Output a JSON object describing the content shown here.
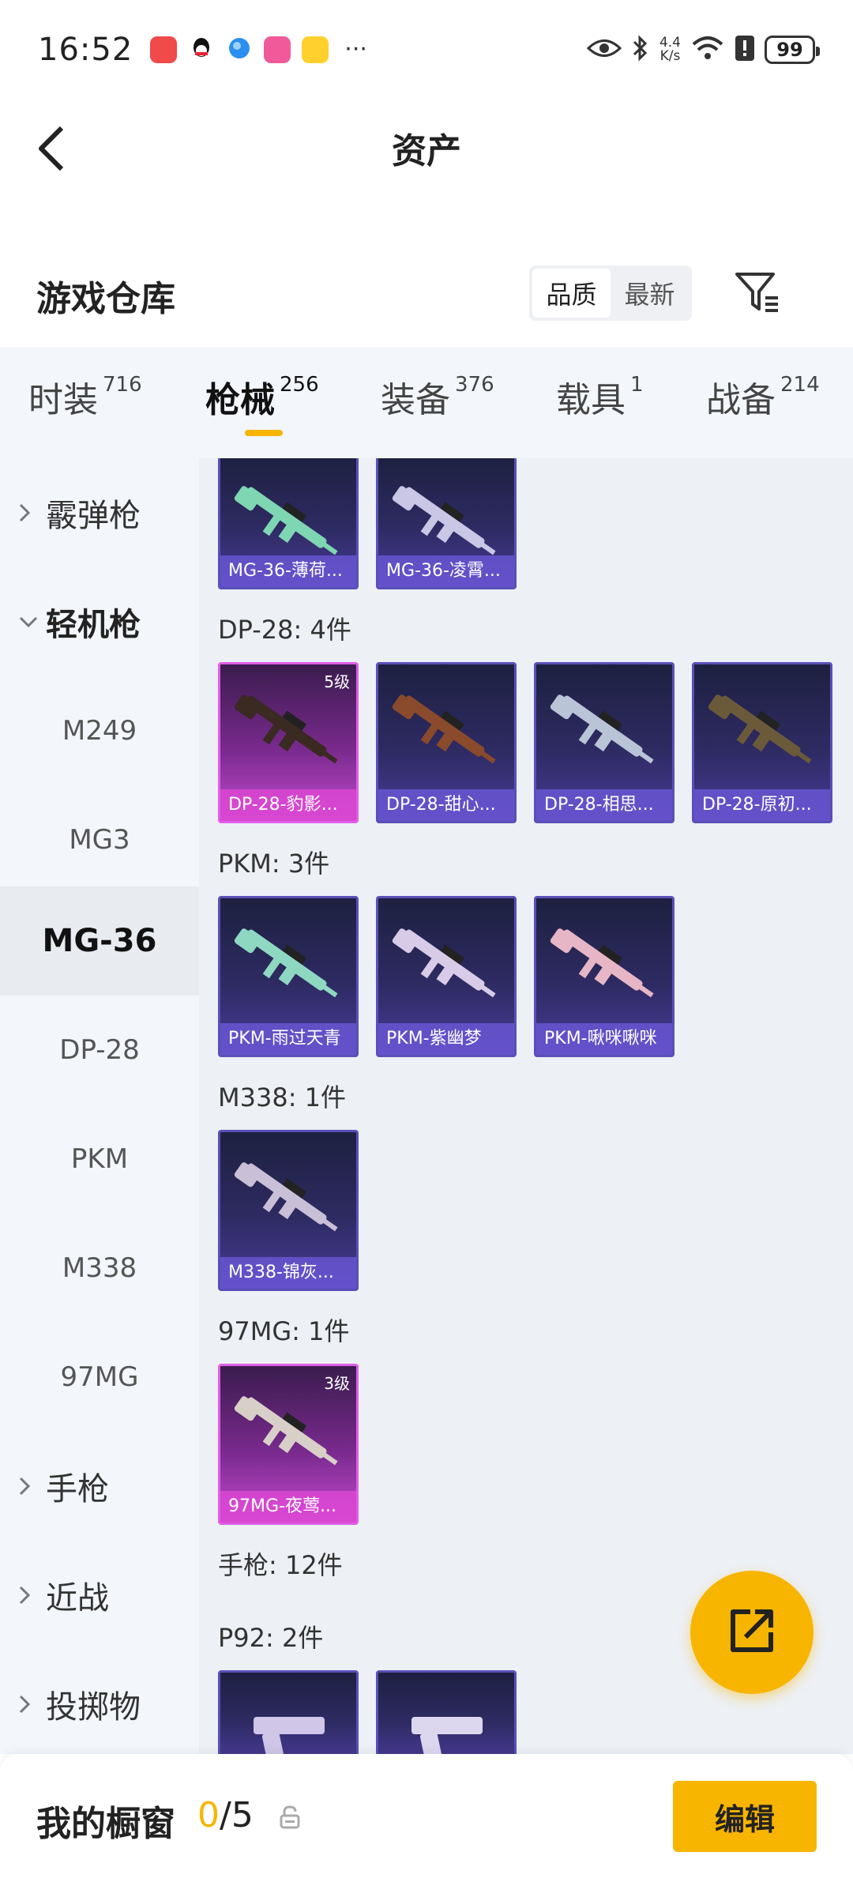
{
  "status_bar": {
    "time": "16:52",
    "more": "···",
    "net_speed_value": "4.4",
    "net_speed_unit": "K/s",
    "battery": "99",
    "app_icons": [
      "red-app-icon",
      "qq-icon",
      "blue-app-icon",
      "pink-app-icon",
      "yellow-app-icon"
    ],
    "icons": [
      "eye-icon",
      "bluetooth-icon",
      "wifi-icon",
      "alert-icon",
      "battery-icon"
    ]
  },
  "header": {
    "back_icon": "chevron-left-icon",
    "title": "资产"
  },
  "warehouse": {
    "title": "游戏仓库",
    "sort_options": [
      "品质",
      "最新"
    ],
    "sort_selected": "品质",
    "filter_icon": "filter-icon"
  },
  "tabs": [
    {
      "label": "时装",
      "count": "716"
    },
    {
      "label": "枪械",
      "count": "256",
      "active": true
    },
    {
      "label": "装备",
      "count": "376"
    },
    {
      "label": "载具",
      "count": "1"
    },
    {
      "label": "战备",
      "count": "214"
    }
  ],
  "sidebar": {
    "items": [
      {
        "label": "霰弹枪",
        "type": "group",
        "expanded": false
      },
      {
        "label": "轻机枪",
        "type": "group",
        "expanded": true
      },
      {
        "label": "M249",
        "type": "sub"
      },
      {
        "label": "MG3",
        "type": "sub"
      },
      {
        "label": "MG-36",
        "type": "sub",
        "active": true
      },
      {
        "label": "DP-28",
        "type": "sub"
      },
      {
        "label": "PKM",
        "type": "sub"
      },
      {
        "label": "M338",
        "type": "sub"
      },
      {
        "label": "97MG",
        "type": "sub"
      },
      {
        "label": "手枪",
        "type": "group",
        "expanded": false
      },
      {
        "label": "近战",
        "type": "group",
        "expanded": false
      },
      {
        "label": "投掷物",
        "type": "group",
        "expanded": false
      }
    ]
  },
  "sections": {
    "mg36": {
      "items": [
        {
          "name": "MG-36-薄荷...",
          "tier": "purple",
          "gun_color": "#7fd6b3"
        },
        {
          "name": "MG-36-凌霄...",
          "tier": "purple",
          "gun_color": "#c9c6e6"
        }
      ]
    },
    "dp28": {
      "title": "DP-28: 4件",
      "items": [
        {
          "name": "DP-28-豹影...",
          "tier": "pink",
          "level": "5级",
          "gun_color": "#3a2a22"
        },
        {
          "name": "DP-28-甜心...",
          "tier": "purple",
          "gun_color": "#8a4a2c"
        },
        {
          "name": "DP-28-相思...",
          "tier": "purple",
          "gun_color": "#b9c4d6"
        },
        {
          "name": "DP-28-原初...",
          "tier": "purple",
          "gun_color": "#6b5a3a"
        }
      ]
    },
    "pkm": {
      "title": "PKM: 3件",
      "items": [
        {
          "name": "PKM-雨过天青",
          "tier": "purple",
          "gun_color": "#8ed8c2"
        },
        {
          "name": "PKM-紫幽梦",
          "tier": "purple",
          "gun_color": "#d7cbe8"
        },
        {
          "name": "PKM-啾咪啾咪",
          "tier": "purple",
          "gun_color": "#e7b6c6"
        }
      ]
    },
    "m338": {
      "title": "M338: 1件",
      "items": [
        {
          "name": "M338-锦灰...",
          "tier": "purple",
          "gun_color": "#c9bfd6"
        }
      ]
    },
    "mg97": {
      "title": "97MG: 1件",
      "items": [
        {
          "name": "97MG-夜莺...",
          "tier": "pink",
          "level": "3级",
          "gun_color": "#d8d0c8"
        }
      ]
    },
    "pistol": {
      "title": "手枪: 12件"
    },
    "p92": {
      "title": "P92: 2件",
      "items": [
        {
          "name": "",
          "tier": "purple",
          "gun_color": "#cfc6e8"
        },
        {
          "name": "",
          "tier": "purple",
          "gun_color": "#dcd7ef"
        }
      ]
    }
  },
  "fab": {
    "icon": "share-icon"
  },
  "showcase": {
    "title": "我的橱窗",
    "current": "0",
    "separator": "/",
    "total": "5",
    "lock_icon": "lock-icon",
    "edit_label": "编辑"
  },
  "colors": {
    "accent": "#f7b500",
    "purple_card": "#2e2b63",
    "pink_card": "#c34bd0",
    "sidebar_bg": "#f3f6fb",
    "content_bg": "#edf0f5"
  }
}
